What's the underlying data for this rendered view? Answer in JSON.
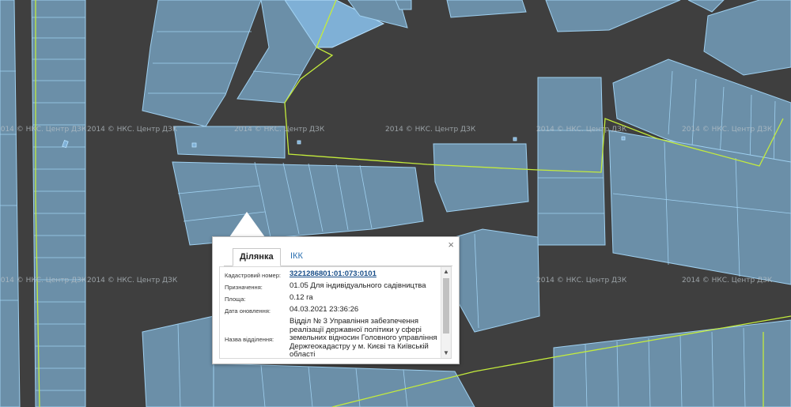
{
  "watermark": "2014 © НКС. Центр ДЗК",
  "colors": {
    "background": "#3f3f3f",
    "parcel": "#6b8fa8",
    "parcel_border": "#9fd0f0",
    "boundary": "#c4ec3c"
  },
  "popup": {
    "close_icon": "×",
    "tabs": [
      {
        "label": "Ділянка",
        "active": true
      },
      {
        "label": "ІКК",
        "active": false
      }
    ],
    "fields": [
      {
        "label": "Кадастровий номер:",
        "value": "3221286801:01:073:0101"
      },
      {
        "label": "Призначення:",
        "value": "01.05 Для індивідуального садівництва"
      },
      {
        "label": "Площа:",
        "value": "0.12 га"
      },
      {
        "label": "Дата оновлення:",
        "value": "04.03.2021 23:36:26"
      },
      {
        "label": "Назва відділення:",
        "value": "Відділ № 3 Управління забезпечення реалізації державної політики у сфері земельних відносин Головного управління Держгеокадастру у м. Києві та Київській області"
      }
    ],
    "scroll_up_icon": "▲",
    "scroll_down_icon": "▼"
  }
}
